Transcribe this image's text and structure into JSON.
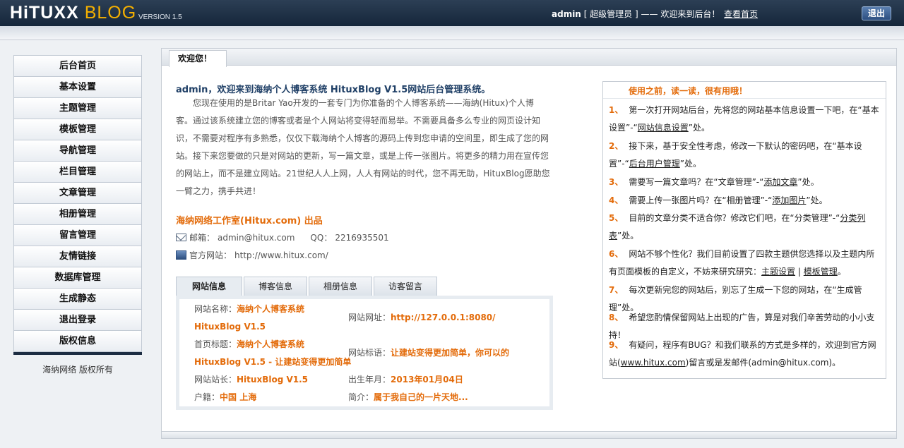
{
  "header": {
    "logo_main": "HiTUXX",
    "logo_accent": "BLOG",
    "version": "VERSION 1.5",
    "user": "admin",
    "role": "[ 超级管理员 ]",
    "welcome": "—— 欢迎来到后台！",
    "home_link": "查看首页",
    "logout": "退出"
  },
  "sidebar": {
    "items": [
      {
        "label": "后台首页"
      },
      {
        "label": "基本设置"
      },
      {
        "label": "主题管理"
      },
      {
        "label": "模板管理"
      },
      {
        "label": "导航管理"
      },
      {
        "label": "栏目管理"
      },
      {
        "label": "文章管理"
      },
      {
        "label": "相册管理"
      },
      {
        "label": "留言管理"
      },
      {
        "label": "友情链接"
      },
      {
        "label": "数据库管理"
      },
      {
        "label": "生成静态"
      },
      {
        "label": "退出登录"
      },
      {
        "label": "版权信息"
      }
    ],
    "copyright": "海纳网络  版权所有"
  },
  "main": {
    "tab_label": "欢迎您！",
    "intro_title": "admin，欢迎来到海纳个人博客系统 HituxBlog V1.5网站后台管理系统。",
    "intro_text": "您现在使用的是Britar Yao开发的一套专门为你准备的个人博客系统——海纳(Hitux)个人博客。通过该系统建立您的博客或者是个人网站将变得轻而易举。不需要具备多么专业的网页设计知识，不需要对程序有多熟悉，仅仅下载海纳个人博客的源码上传到您申请的空间里，即生成了您的网站。接下来您要做的只是对网站的更新，写一篇文章，或是上传一张图片。将更多的精力用在宣传您的网站上，而不是建立网站。21世纪人人上网，人人有网站的时代，您不再无助，HituxBlog愿助您一臂之力，携手共进！",
    "studio": "海纳网络工作室(Hitux.com) 出品",
    "email_label": "邮箱：",
    "email": "admin@hitux.com",
    "qq_label": "QQ：",
    "qq": "2216935501",
    "site_label": "官方网站：",
    "site": "http://www.hitux.com/"
  },
  "info": {
    "tabs": [
      {
        "label": "网站信息"
      },
      {
        "label": "博客信息"
      },
      {
        "label": "相册信息"
      },
      {
        "label": "访客留言"
      }
    ],
    "site_name_label": "网站名称：",
    "site_name_1": "海纳个人博客系统",
    "site_name_2": "HituxBlog V1.5",
    "site_url_label": "网站网址：",
    "site_url": "http://127.0.0.1:8080/",
    "home_title_label": "首页标题：",
    "home_title_1": "海纳个人博客系统",
    "home_title_2": "HituxBlog V1.5 - 让建站变得更加简单",
    "slogan_label": "网站标语：",
    "slogan": "让建站变得更加简单，你可以的",
    "owner_label": "网站站长：",
    "owner": "HituxBlog V1.5",
    "birth_label": "出生年月：",
    "birth": "2013年01月04日",
    "home_label": "户籍：",
    "home": "中国 上海",
    "bio_label": "简介：",
    "bio": "属于我自己的一片天地..."
  },
  "tips": {
    "title": "使用之前，读一读，很有用哦！",
    "items": [
      {
        "num": "1、",
        "text_a": "第一次打开网站后台，先将您的网站基本信息设置一下吧，在“基本设置”-“",
        "link": "网站信息设置",
        "text_b": "”处。"
      },
      {
        "num": "2、",
        "text_a": "接下来，基于安全性考虑，修改一下默认的密码吧，在“基本设置”-“",
        "link": "后台用户管理",
        "text_b": "”处。"
      },
      {
        "num": "3、",
        "text_a": "需要写一篇文章吗？在“文章管理”-“",
        "link": "添加文章",
        "text_b": "”处。"
      },
      {
        "num": "4、",
        "text_a": "需要上传一张图片吗？在“相册管理”-“",
        "link": "添加图片",
        "text_b": "”处。"
      },
      {
        "num": "5、",
        "text_a": "目前的文章分类不适合你？修改它们吧，在“分类管理”-“",
        "link": "分类列表",
        "text_b": "”处。"
      },
      {
        "num": "6、",
        "text_a": "网站不够个性化？我们目前设置了四款主题供您选择以及主题内所有页面模板的自定义，不妨来研究研究：",
        "link": "主题设置",
        "sep": "|",
        "link2": "模板管理",
        "text_b": "。"
      },
      {
        "num": "7、",
        "text_a": "每次更新完您的网站后，别忘了生成一下您的网站，在“生成管理”处。"
      },
      {
        "num": "8、",
        "text_a": "希望您酌情保留网站上出现的广告，算是对我们辛苦劳动的小小支持！"
      },
      {
        "num": "9、",
        "text_a": "有疑问，程序有BUG？和我们联系的方式是多样的，欢迎到官方网站(",
        "link": "www.hitux.com",
        "text_b": ")留言或是发邮件(admin@hitux.com)。"
      }
    ]
  }
}
